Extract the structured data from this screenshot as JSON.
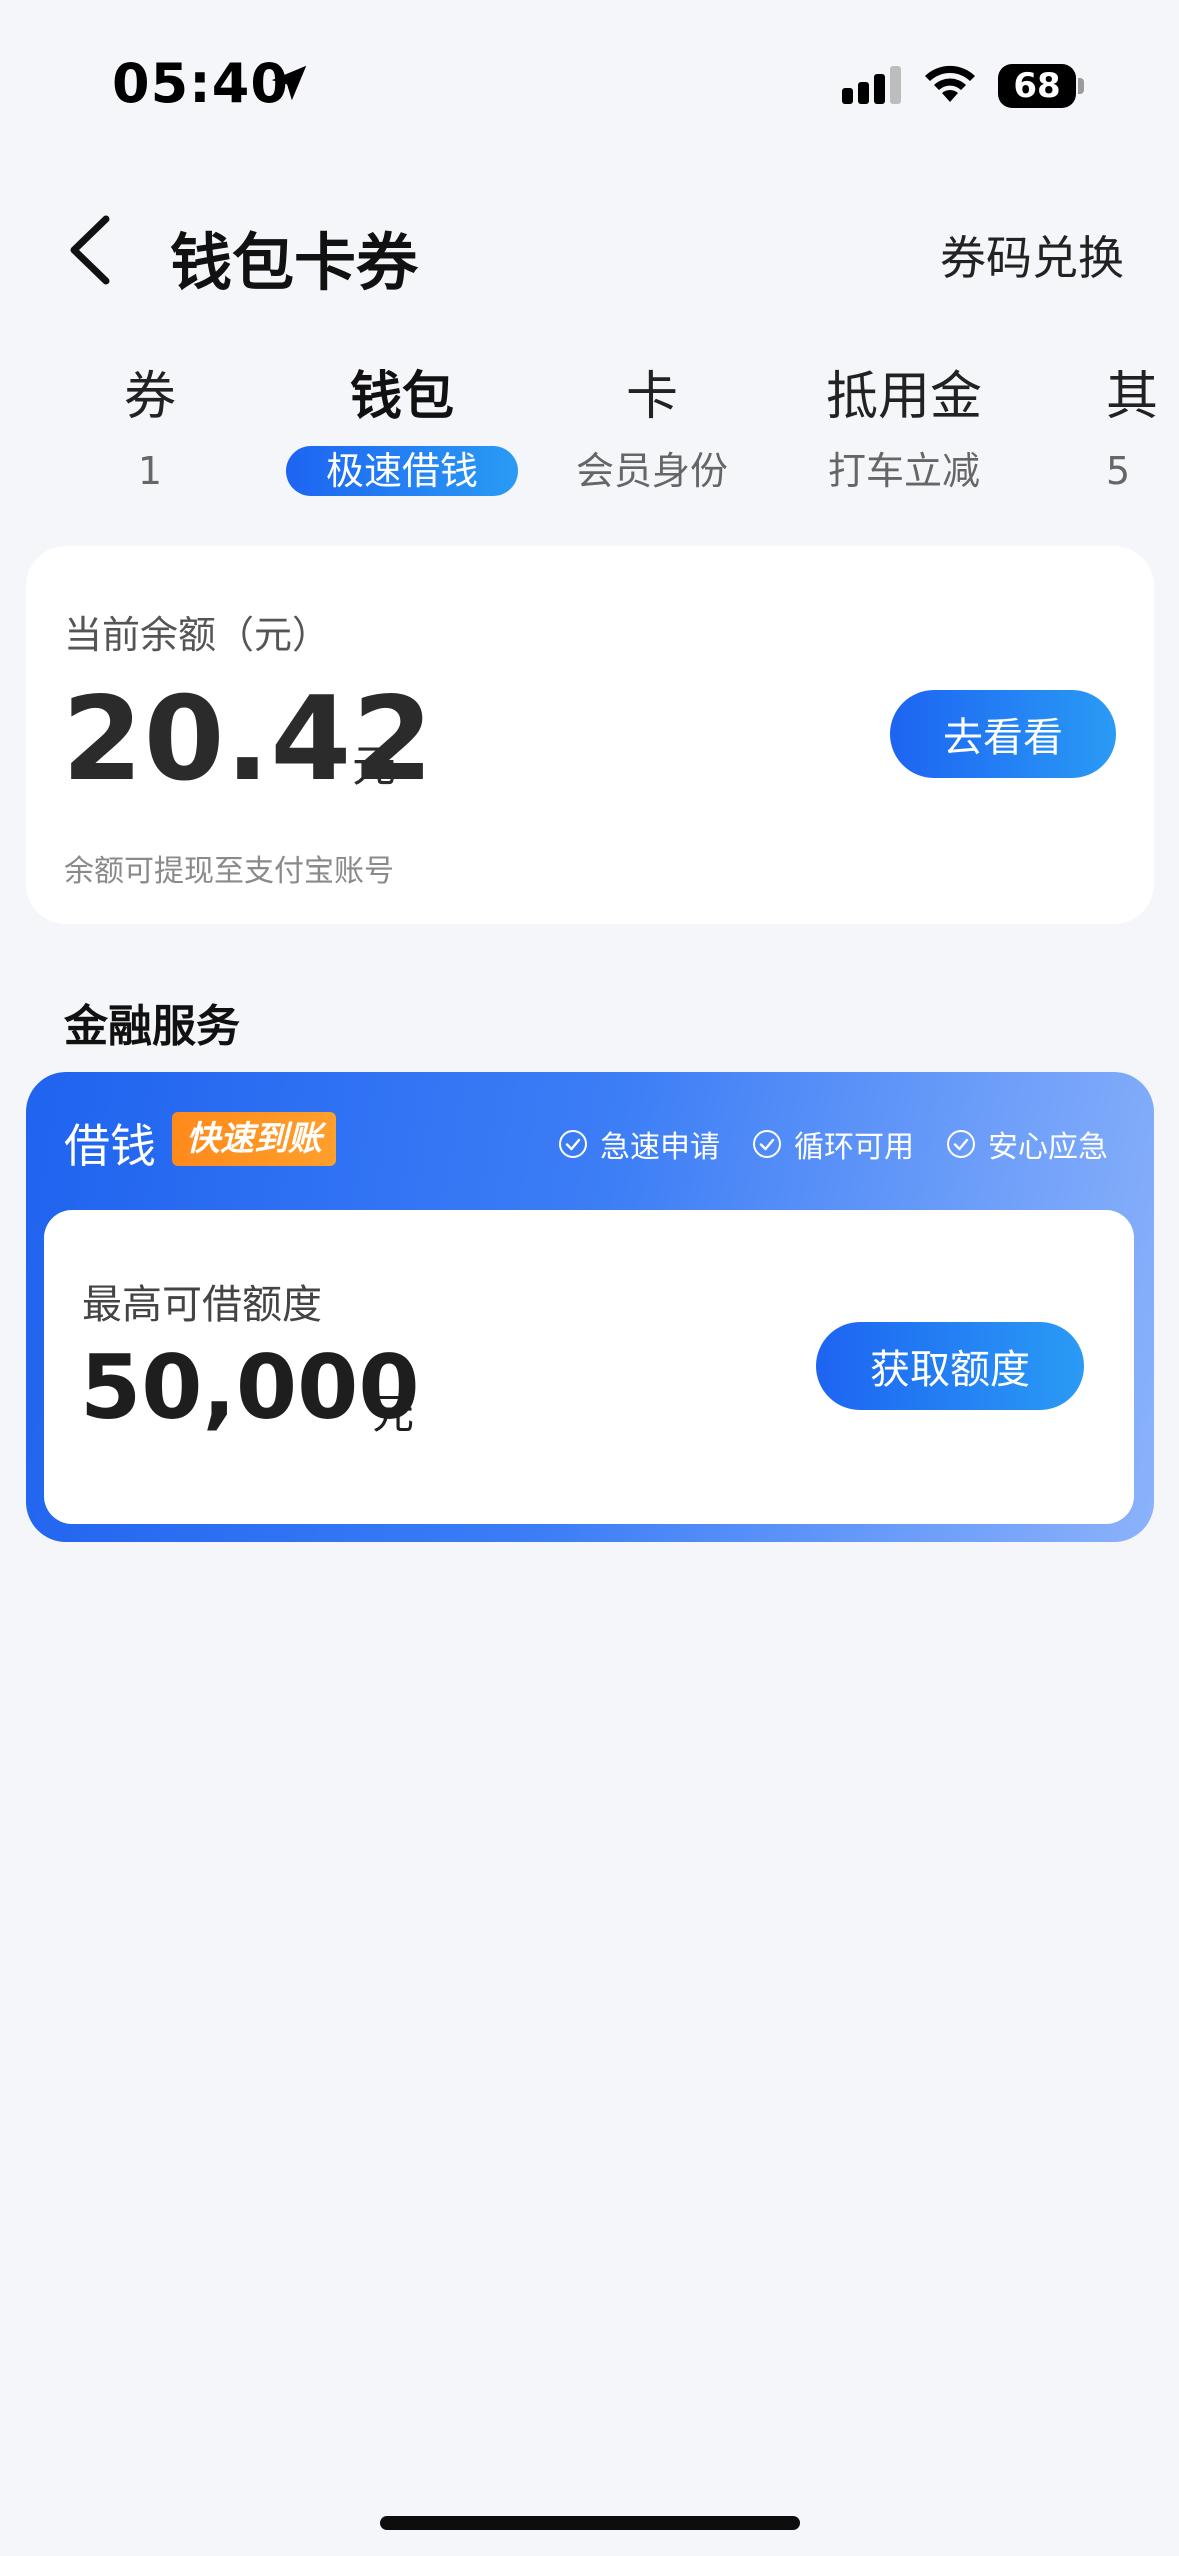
{
  "status_bar": {
    "time": "05:40",
    "battery": "68",
    "icons": [
      "location-arrow-icon",
      "signal-icon",
      "wifi-icon",
      "battery-icon"
    ]
  },
  "header": {
    "back_icon": "chevron-left-icon",
    "title": "钱包卡券",
    "redeem": "券码兑换"
  },
  "tabs": [
    {
      "label": "券",
      "sub": "1",
      "active": false
    },
    {
      "label": "钱包",
      "sub": "极速借钱",
      "active": true
    },
    {
      "label": "卡",
      "sub": "会员身份",
      "active": false
    },
    {
      "label": "抵用金",
      "sub": "打车立减",
      "active": false
    },
    {
      "label": "其",
      "sub": "5",
      "active": false
    }
  ],
  "balance": {
    "label": "当前余额（元）",
    "amount": "20.42",
    "unit": "元",
    "button": "去看看",
    "hint": "余额可提现至支付宝账号"
  },
  "finance": {
    "section_title": "金融服务",
    "loan_title": "借钱",
    "badge": "快速到账",
    "features": [
      "急速申请",
      "循环可用",
      "安心应急"
    ],
    "limit_label": "最高可借额度",
    "limit_amount": "50,000",
    "limit_unit": "元",
    "button": "获取额度"
  },
  "colors": {
    "accent_blue": "#1d64f2",
    "badge_orange": "#ff8a1a",
    "background": "#f4f6f9"
  }
}
